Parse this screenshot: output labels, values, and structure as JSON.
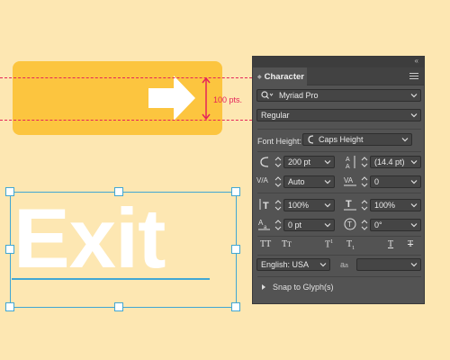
{
  "artwork": {
    "measure_label": "100 pts.",
    "sample_text": "Exit",
    "colors": {
      "background": "#fde7b2",
      "sign": "#fcc53f",
      "measure": "#e5245a",
      "selection": "#41a7d3"
    }
  },
  "panel": {
    "tab_label": "Character",
    "font_family": "Myriad Pro",
    "font_style": "Regular",
    "font_height_label": "Font Height:",
    "font_height_value": "Caps Height",
    "font_size": "200 pt",
    "leading": "(14.4 pt)",
    "kerning": "Auto",
    "tracking": "0",
    "vertical_scale": "100%",
    "horizontal_scale": "100%",
    "baseline_shift": "0 pt",
    "rotation": "0°",
    "language": "English: USA",
    "antialias_label": "a",
    "antialias_sub": "a",
    "snap_label": "Snap to Glyph(s)"
  }
}
